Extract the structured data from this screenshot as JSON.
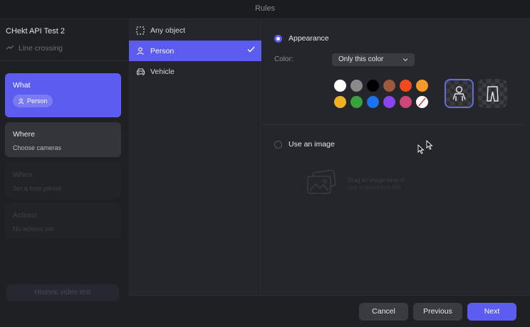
{
  "window": {
    "title": "Rules"
  },
  "left": {
    "app_title": "CHekt API Test 2",
    "rule_type": "Line crossing",
    "cards": {
      "what": {
        "label": "What",
        "chip": "Person"
      },
      "where": {
        "label": "Where",
        "sub": "Choose cameras"
      },
      "when": {
        "label": "When",
        "sub": "Set a time period"
      },
      "actions": {
        "label": "Actions",
        "sub": "No actions set"
      }
    },
    "historic_button": "Historic video test"
  },
  "objects": {
    "any": "Any object",
    "person": "Person",
    "vehicle": "Vehicle",
    "selected": "Person"
  },
  "appearance": {
    "label": "Appearance",
    "color_label": "Color:",
    "dropdown_value": "Only this color",
    "swatches": [
      "#ffffff",
      "#8a8a8a",
      "#000000",
      "#9c5a3c",
      "#f04a1e",
      "#f59a28",
      "#f0b020",
      "#3aa23a",
      "#1a73f0",
      "#8a45f0",
      "#d0457a",
      "none"
    ],
    "style_tiles": [
      "upper-body-icon",
      "lower-body-icon"
    ]
  },
  "image": {
    "label": "Use an image",
    "drop_text": "Drag an image here or",
    "drop_sub": "click to upload from files"
  },
  "footer": {
    "cancel": "Cancel",
    "previous": "Previous",
    "next": "Next"
  },
  "colors": {
    "accent": "#5c5cf0"
  }
}
